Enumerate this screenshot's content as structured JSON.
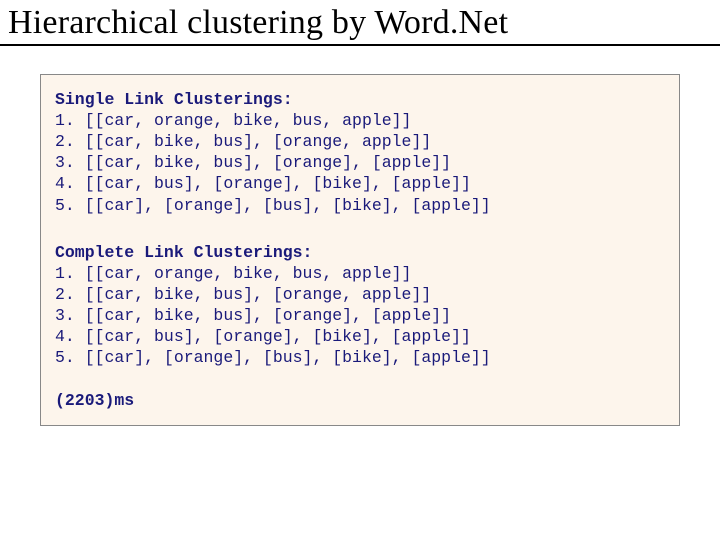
{
  "title": "Hierarchical clustering by Word.Net",
  "sections": [
    {
      "heading": "Single Link Clusterings:",
      "rows": [
        "1. [[car, orange, bike, bus, apple]]",
        "2. [[car, bike, bus], [orange, apple]]",
        "3. [[car, bike, bus], [orange], [apple]]",
        "4. [[car, bus], [orange], [bike], [apple]]",
        "5. [[car], [orange], [bus], [bike], [apple]]"
      ]
    },
    {
      "heading": "Complete Link Clusterings:",
      "rows": [
        "1. [[car, orange, bike, bus, apple]]",
        "2. [[car, bike, bus], [orange, apple]]",
        "3. [[car, bike, bus], [orange], [apple]]",
        "4. [[car, bus], [orange], [bike], [apple]]",
        "5. [[car], [orange], [bus], [bike], [apple]]"
      ]
    }
  ],
  "timing": "(2203)ms"
}
